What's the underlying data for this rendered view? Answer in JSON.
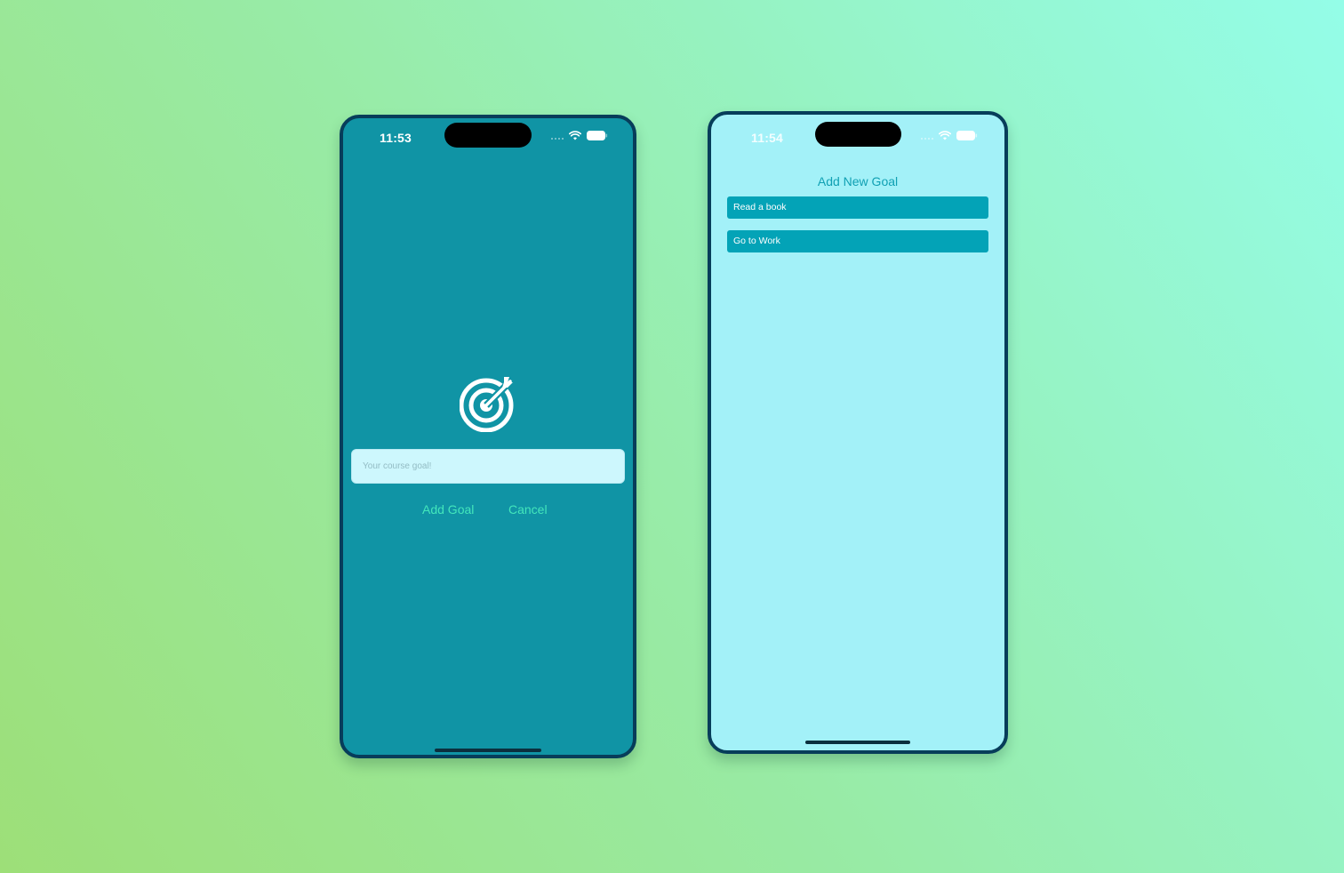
{
  "colors": {
    "modal_background": "#1094a5",
    "list_background": "#a3f1f8",
    "accent_text": "#43e6bb",
    "goal_item": "#03a3b7",
    "phone_frame": "#073d5a"
  },
  "modal_screen": {
    "status_time": "11:53",
    "icon": "target-icon",
    "input": {
      "placeholder": "Your course goal!",
      "value": ""
    },
    "add_goal_label": "Add Goal",
    "cancel_label": "Cancel"
  },
  "list_screen": {
    "status_time": "11:54",
    "add_new_goal_label": "Add New Goal",
    "goals": [
      "Read a book",
      "Go to Work"
    ]
  }
}
